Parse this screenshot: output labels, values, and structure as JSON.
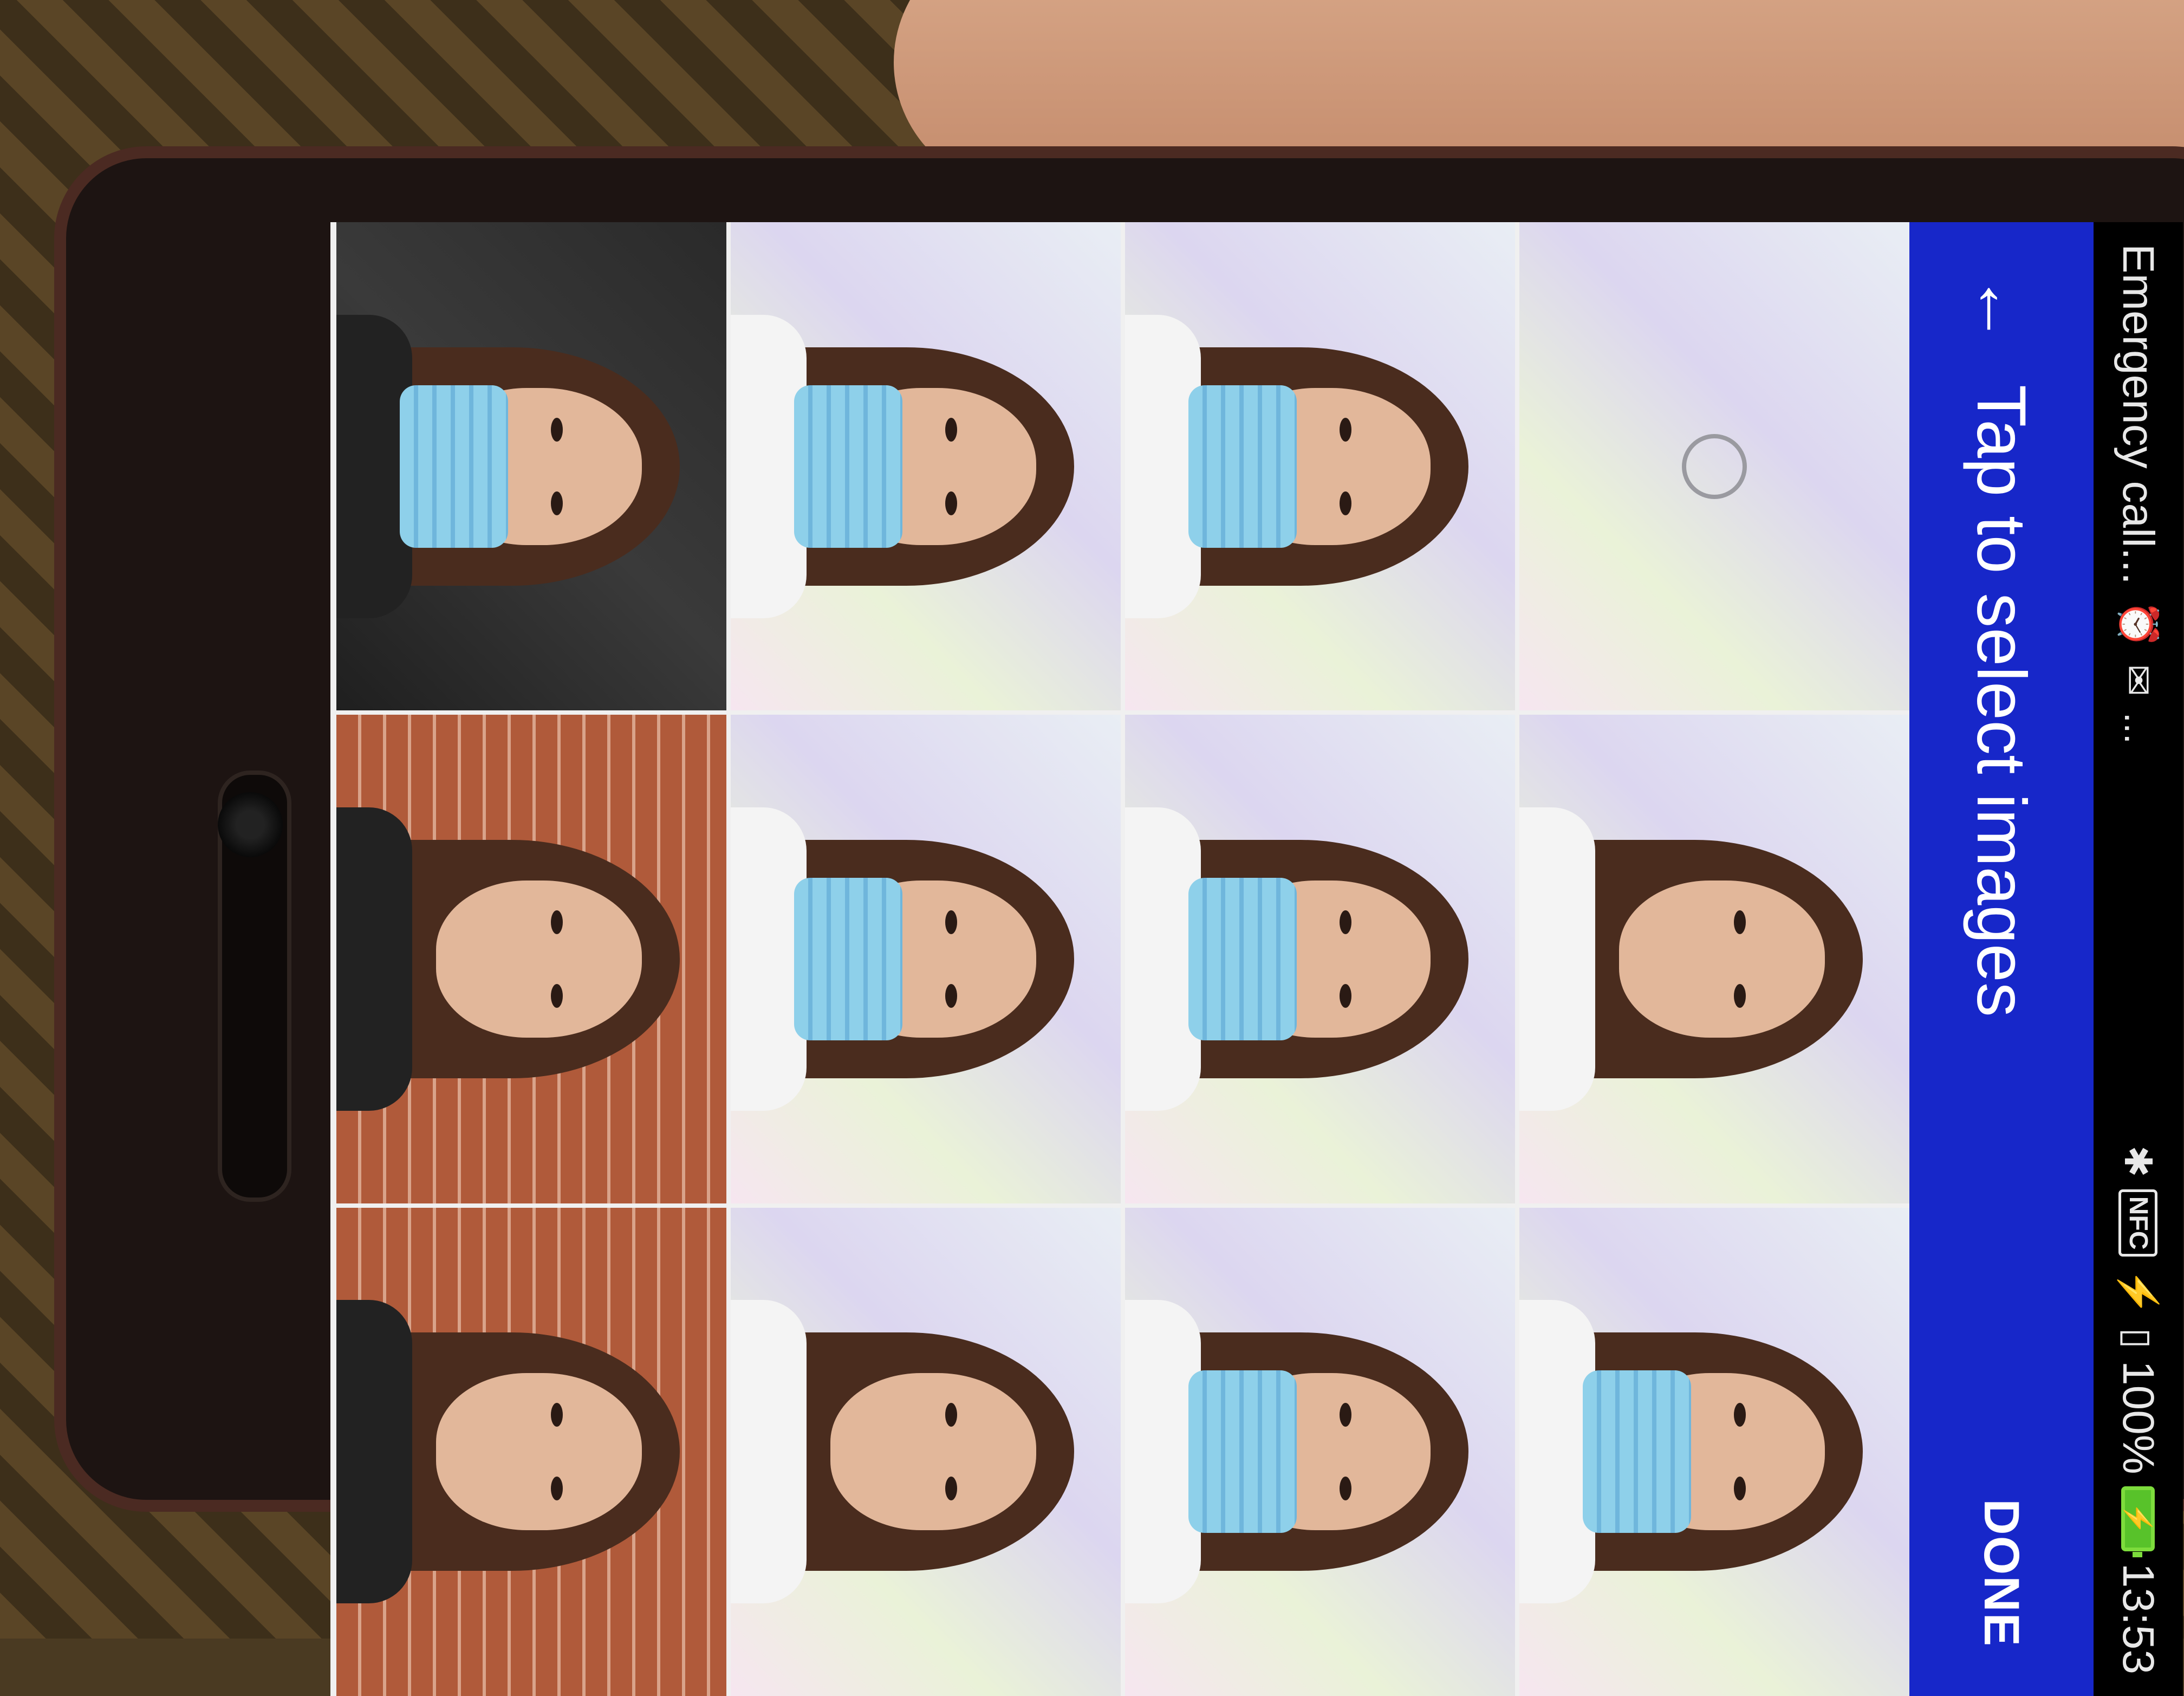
{
  "status_bar": {
    "carrier_text": "Emergency call...",
    "notification_icons": [
      "alarm-icon",
      "gmail-icon",
      "more-notifications-icon"
    ],
    "more_glyph": "...",
    "nfc_label": "NFC",
    "battery_percent": "100%",
    "time": "13:53"
  },
  "app_bar": {
    "back_glyph": "←",
    "title": "Tap to select images",
    "done_label": "DONE",
    "background_color": "#1727c9"
  },
  "gallery": {
    "columns": 3,
    "tiles": [
      {
        "kind": "camera",
        "bg": "wall"
      },
      {
        "kind": "selfie",
        "bg": "wall",
        "mask": false,
        "shirt": "light"
      },
      {
        "kind": "selfie",
        "bg": "wall",
        "mask": true,
        "shirt": "light"
      },
      {
        "kind": "selfie",
        "bg": "wall",
        "mask": true,
        "shirt": "light"
      },
      {
        "kind": "selfie",
        "bg": "wall",
        "mask": true,
        "shirt": "light"
      },
      {
        "kind": "selfie",
        "bg": "wall",
        "mask": true,
        "shirt": "light"
      },
      {
        "kind": "selfie",
        "bg": "wall",
        "mask": true,
        "shirt": "light"
      },
      {
        "kind": "selfie",
        "bg": "wall",
        "mask": true,
        "shirt": "light"
      },
      {
        "kind": "selfie",
        "bg": "wall",
        "mask": false,
        "shirt": "light"
      },
      {
        "kind": "selfie",
        "bg": "dark",
        "mask": true,
        "shirt": "dark"
      },
      {
        "kind": "outfit",
        "bg": "brick",
        "mask": false,
        "shirt": "dark"
      },
      {
        "kind": "outfit",
        "bg": "brick",
        "mask": false,
        "shirt": "dark"
      }
    ]
  }
}
